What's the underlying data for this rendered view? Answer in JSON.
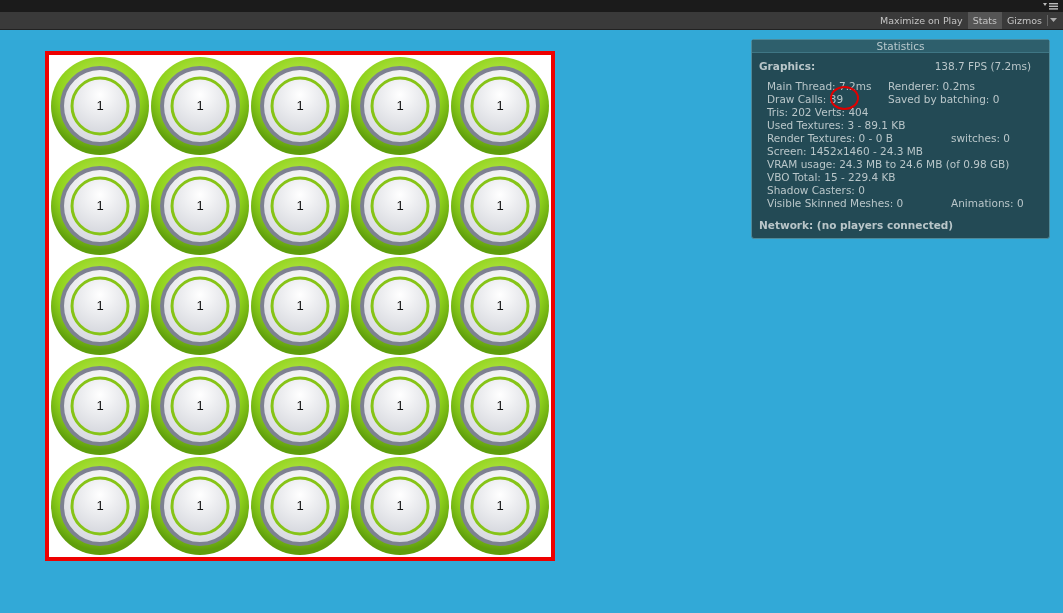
{
  "toolbar": {
    "buttons": [
      {
        "label": "Maximize on Play",
        "selected": false
      },
      {
        "label": "Stats",
        "selected": true
      },
      {
        "label": "Gizmos",
        "selected": false
      }
    ]
  },
  "grid": {
    "buttons": [
      "1",
      "1",
      "1",
      "1",
      "1",
      "1",
      "1",
      "1",
      "1",
      "1",
      "1",
      "1",
      "1",
      "1",
      "1",
      "1",
      "1",
      "1",
      "1",
      "1",
      "1",
      "1",
      "1",
      "1",
      "1"
    ]
  },
  "statistics": {
    "title": "Statistics",
    "graphics_label": "Graphics:",
    "fps": "138.7 FPS (7.2ms)",
    "rows": [
      {
        "left": "Main Thread: 7.2ms",
        "right": "Renderer: 0.2ms",
        "kind": "near"
      },
      {
        "left": "Draw Calls: 39",
        "right": "Saved by batching: 0",
        "kind": "near"
      },
      {
        "left": "Tris: 202 Verts: 404",
        "kind": "single"
      },
      {
        "left": "Used Textures: 3 - 89.1 KB",
        "kind": "single"
      },
      {
        "left": "Render Textures: 0 - 0 B",
        "right": "switches: 0",
        "kind": "far"
      },
      {
        "left": "Screen: 1452x1460 - 24.3 MB",
        "kind": "single"
      },
      {
        "left": "VRAM usage: 24.3 MB to 24.6 MB (of 0.98 GB)",
        "kind": "single"
      },
      {
        "left": "VBO Total: 15 - 229.4 KB",
        "kind": "single"
      },
      {
        "left": "Shadow Casters: 0",
        "kind": "single"
      },
      {
        "left": "Visible Skinned Meshes: 0",
        "right": "Animations: 0",
        "kind": "far"
      }
    ],
    "network": "Network: (no players connected)"
  }
}
